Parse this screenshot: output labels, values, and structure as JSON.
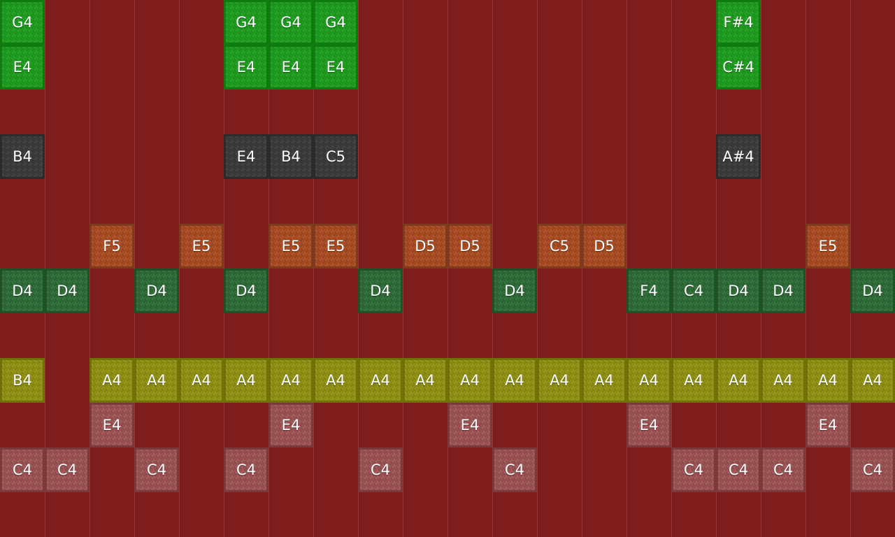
{
  "colors": {
    "background": "#7f1c1c",
    "grid_line": "#963737",
    "green": "#1c9a1c",
    "gray": "#3a3a3a",
    "orange": "#a84a20",
    "dkgreen": "#2c6a36",
    "yellow": "#8e8e10",
    "pink": "#9a4f50"
  },
  "grid": {
    "columns": 20,
    "rows": 12
  },
  "notes": [
    {
      "label": "G4",
      "col": 0,
      "row": 0,
      "kind": "green"
    },
    {
      "label": "G4",
      "col": 5,
      "row": 0,
      "kind": "green"
    },
    {
      "label": "G4",
      "col": 6,
      "row": 0,
      "kind": "green"
    },
    {
      "label": "G4",
      "col": 7,
      "row": 0,
      "kind": "green"
    },
    {
      "label": "F#4",
      "col": 16,
      "row": 0,
      "kind": "green"
    },
    {
      "label": "E4",
      "col": 0,
      "row": 1,
      "kind": "green"
    },
    {
      "label": "E4",
      "col": 5,
      "row": 1,
      "kind": "green"
    },
    {
      "label": "E4",
      "col": 6,
      "row": 1,
      "kind": "green"
    },
    {
      "label": "E4",
      "col": 7,
      "row": 1,
      "kind": "green"
    },
    {
      "label": "C#4",
      "col": 16,
      "row": 1,
      "kind": "green"
    },
    {
      "label": "B4",
      "col": 0,
      "row": 3,
      "kind": "gray"
    },
    {
      "label": "E4",
      "col": 5,
      "row": 3,
      "kind": "gray"
    },
    {
      "label": "B4",
      "col": 6,
      "row": 3,
      "kind": "gray"
    },
    {
      "label": "C5",
      "col": 7,
      "row": 3,
      "kind": "gray"
    },
    {
      "label": "A#4",
      "col": 16,
      "row": 3,
      "kind": "gray"
    },
    {
      "label": "F5",
      "col": 2,
      "row": 5,
      "kind": "orange"
    },
    {
      "label": "E5",
      "col": 4,
      "row": 5,
      "kind": "orange"
    },
    {
      "label": "E5",
      "col": 6,
      "row": 5,
      "kind": "orange"
    },
    {
      "label": "E5",
      "col": 7,
      "row": 5,
      "kind": "orange"
    },
    {
      "label": "D5",
      "col": 9,
      "row": 5,
      "kind": "orange"
    },
    {
      "label": "D5",
      "col": 10,
      "row": 5,
      "kind": "orange"
    },
    {
      "label": "C5",
      "col": 12,
      "row": 5,
      "kind": "orange"
    },
    {
      "label": "D5",
      "col": 13,
      "row": 5,
      "kind": "orange"
    },
    {
      "label": "E5",
      "col": 18,
      "row": 5,
      "kind": "orange"
    },
    {
      "label": "D4",
      "col": 0,
      "row": 6,
      "kind": "dkgreen"
    },
    {
      "label": "D4",
      "col": 1,
      "row": 6,
      "kind": "dkgreen"
    },
    {
      "label": "D4",
      "col": 3,
      "row": 6,
      "kind": "dkgreen"
    },
    {
      "label": "D4",
      "col": 5,
      "row": 6,
      "kind": "dkgreen"
    },
    {
      "label": "D4",
      "col": 8,
      "row": 6,
      "kind": "dkgreen"
    },
    {
      "label": "D4",
      "col": 11,
      "row": 6,
      "kind": "dkgreen"
    },
    {
      "label": "F4",
      "col": 14,
      "row": 6,
      "kind": "dkgreen"
    },
    {
      "label": "C4",
      "col": 15,
      "row": 6,
      "kind": "dkgreen"
    },
    {
      "label": "D4",
      "col": 16,
      "row": 6,
      "kind": "dkgreen"
    },
    {
      "label": "D4",
      "col": 17,
      "row": 6,
      "kind": "dkgreen"
    },
    {
      "label": "D4",
      "col": 19,
      "row": 6,
      "kind": "dkgreen"
    },
    {
      "label": "B4",
      "col": 0,
      "row": 8,
      "kind": "yellow"
    },
    {
      "label": "A4",
      "col": 2,
      "row": 8,
      "kind": "yellow"
    },
    {
      "label": "A4",
      "col": 3,
      "row": 8,
      "kind": "yellow"
    },
    {
      "label": "A4",
      "col": 4,
      "row": 8,
      "kind": "yellow"
    },
    {
      "label": "A4",
      "col": 5,
      "row": 8,
      "kind": "yellow"
    },
    {
      "label": "A4",
      "col": 6,
      "row": 8,
      "kind": "yellow"
    },
    {
      "label": "A4",
      "col": 7,
      "row": 8,
      "kind": "yellow"
    },
    {
      "label": "A4",
      "col": 8,
      "row": 8,
      "kind": "yellow"
    },
    {
      "label": "A4",
      "col": 9,
      "row": 8,
      "kind": "yellow"
    },
    {
      "label": "A4",
      "col": 10,
      "row": 8,
      "kind": "yellow"
    },
    {
      "label": "A4",
      "col": 11,
      "row": 8,
      "kind": "yellow"
    },
    {
      "label": "A4",
      "col": 12,
      "row": 8,
      "kind": "yellow"
    },
    {
      "label": "A4",
      "col": 13,
      "row": 8,
      "kind": "yellow"
    },
    {
      "label": "A4",
      "col": 14,
      "row": 8,
      "kind": "yellow"
    },
    {
      "label": "A4",
      "col": 15,
      "row": 8,
      "kind": "yellow"
    },
    {
      "label": "A4",
      "col": 16,
      "row": 8,
      "kind": "yellow"
    },
    {
      "label": "A4",
      "col": 17,
      "row": 8,
      "kind": "yellow"
    },
    {
      "label": "A4",
      "col": 18,
      "row": 8,
      "kind": "yellow"
    },
    {
      "label": "A4",
      "col": 19,
      "row": 8,
      "kind": "yellow"
    },
    {
      "label": "E4",
      "col": 2,
      "row": 9,
      "kind": "pink"
    },
    {
      "label": "E4",
      "col": 6,
      "row": 9,
      "kind": "pink"
    },
    {
      "label": "E4",
      "col": 10,
      "row": 9,
      "kind": "pink"
    },
    {
      "label": "E4",
      "col": 14,
      "row": 9,
      "kind": "pink"
    },
    {
      "label": "E4",
      "col": 18,
      "row": 9,
      "kind": "pink"
    },
    {
      "label": "C4",
      "col": 0,
      "row": 10,
      "kind": "pink"
    },
    {
      "label": "C4",
      "col": 1,
      "row": 10,
      "kind": "pink"
    },
    {
      "label": "C4",
      "col": 3,
      "row": 10,
      "kind": "pink"
    },
    {
      "label": "C4",
      "col": 5,
      "row": 10,
      "kind": "pink"
    },
    {
      "label": "C4",
      "col": 8,
      "row": 10,
      "kind": "pink"
    },
    {
      "label": "C4",
      "col": 11,
      "row": 10,
      "kind": "pink"
    },
    {
      "label": "C4",
      "col": 15,
      "row": 10,
      "kind": "pink"
    },
    {
      "label": "C4",
      "col": 16,
      "row": 10,
      "kind": "pink"
    },
    {
      "label": "C4",
      "col": 17,
      "row": 10,
      "kind": "pink"
    },
    {
      "label": "C4",
      "col": 19,
      "row": 10,
      "kind": "pink"
    }
  ]
}
